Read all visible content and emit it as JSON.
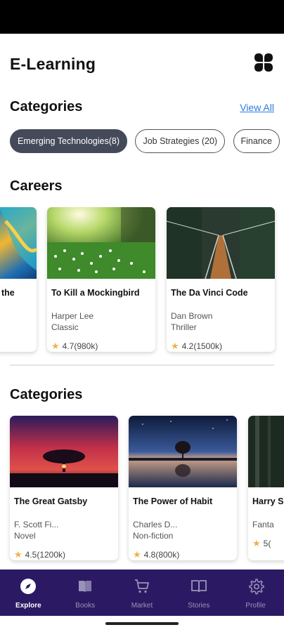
{
  "app": {
    "title": "E-Learning"
  },
  "categories": {
    "title": "Categories",
    "view_all": "View All",
    "chips": [
      {
        "label": "Emerging Technologies(8)",
        "active": true
      },
      {
        "label": "Job Strategies (20)",
        "active": false
      },
      {
        "label": "Finance",
        "active": false
      }
    ]
  },
  "careers": {
    "title": "Careers",
    "books": [
      {
        "title": "the",
        "author": "",
        "genre": "",
        "rating": ""
      },
      {
        "title": "To Kill a Mockingbird",
        "author": "Harper Lee",
        "genre": "Classic",
        "rating": "4.7(980k)"
      },
      {
        "title": "The Da Vinci Code",
        "author": "Dan Brown",
        "genre": "Thriller",
        "rating": "4.2(1500k)"
      }
    ]
  },
  "categories2": {
    "title": "Categories",
    "books": [
      {
        "title": "The Great Gatsby",
        "author": "F. Scott Fi...",
        "genre": "Novel",
        "rating": "4.5(1200k)"
      },
      {
        "title": "The Power of Habit",
        "author": "Charles D...",
        "genre": "Non-fiction",
        "rating": "4.8(800k)"
      },
      {
        "title": "Harry Sorce",
        "author": "",
        "genre": "Fanta",
        "rating": "5("
      }
    ]
  },
  "nav": {
    "items": [
      {
        "label": "Explore",
        "icon": "compass-icon",
        "active": true
      },
      {
        "label": "Books",
        "icon": "book-icon",
        "active": false
      },
      {
        "label": "Market",
        "icon": "cart-icon",
        "active": false
      },
      {
        "label": "Stories",
        "icon": "open-book-icon",
        "active": false
      },
      {
        "label": "Profile",
        "icon": "gear-icon",
        "active": false
      }
    ]
  },
  "colors": {
    "nav_bg": "#2b1a63",
    "accent_link": "#2d7be0",
    "chip_active": "#444a59",
    "star": "#f0b14a"
  }
}
